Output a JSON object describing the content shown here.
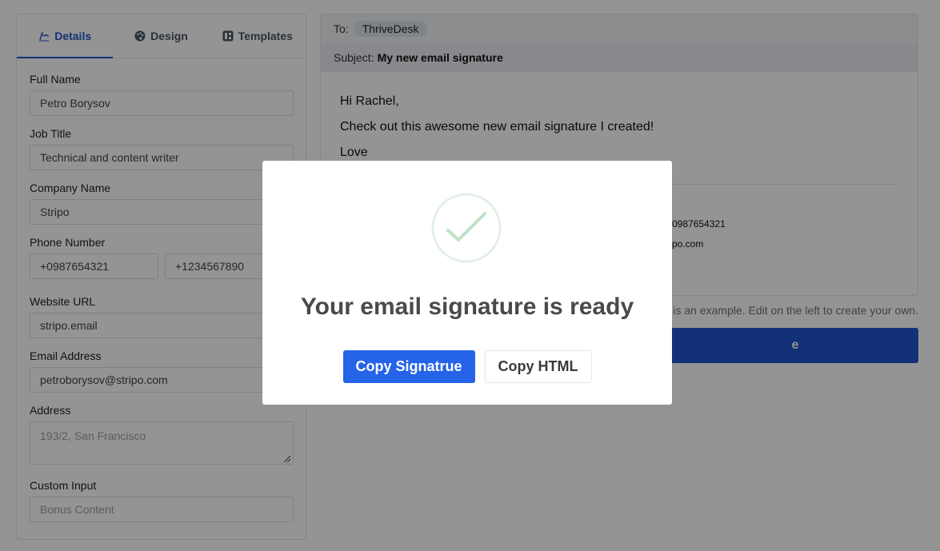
{
  "tabs": [
    {
      "label": "Details",
      "icon": "signature-icon"
    },
    {
      "label": "Design",
      "icon": "palette-icon"
    },
    {
      "label": "Templates",
      "icon": "templates-icon"
    }
  ],
  "form": {
    "full_name": {
      "label": "Full Name",
      "value": "Petro Borysov"
    },
    "job_title": {
      "label": "Job Title",
      "value": "Technical and content writer"
    },
    "company": {
      "label": "Company Name",
      "value": "Stripo"
    },
    "phone": {
      "label": "Phone Number",
      "value1": "+0987654321",
      "value2": "+1234567890"
    },
    "website": {
      "label": "Website URL",
      "value": "stripo.email"
    },
    "email": {
      "label": "Email Address",
      "value": "petroborysov@stripo.com"
    },
    "address": {
      "label": "Address",
      "placeholder": "193/2, San Francisco"
    },
    "custom": {
      "label": "Custom Input",
      "placeholder": "Bonus Content"
    }
  },
  "email": {
    "to_label": "To:",
    "to_value": "ThriveDesk",
    "subject_label": "Subject:",
    "subject_value": "My new email signature",
    "greeting": "Hi Rachel,",
    "message": "Check out this awesome new email signature I created!",
    "closing": "Love",
    "sig_phone_fragment": "0987654321",
    "sig_email_fragment": "po.com"
  },
  "hint_fragment": "is an example. Edit on the left to create your own.",
  "save_fragment": "e",
  "modal": {
    "title": "Your email signature is ready",
    "copy_signature": "Copy Signatrue",
    "copy_html": "Copy HTML"
  },
  "colors": {
    "accent": "#2155cd",
    "check": "#9bd3a6"
  }
}
